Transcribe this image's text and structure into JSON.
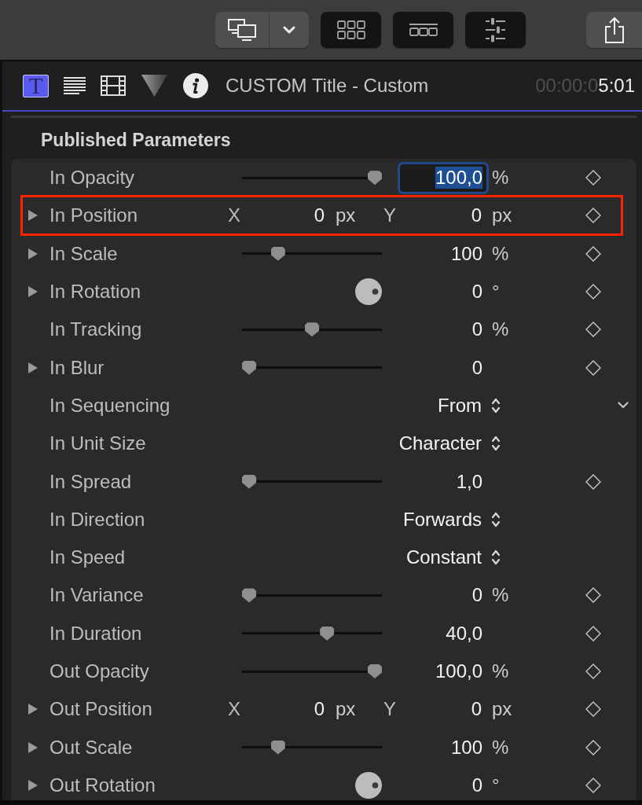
{
  "toolbar": {
    "view_toggles": [
      {
        "kind": "grid",
        "selected": true
      },
      {
        "kind": "timeline",
        "selected": true
      },
      {
        "kind": "sliders",
        "selected": true
      }
    ]
  },
  "inspector": {
    "tabs": [
      {
        "kind": "title",
        "glyph": "T",
        "selected": true
      },
      {
        "kind": "text",
        "selected": false
      },
      {
        "kind": "video",
        "selected": false
      },
      {
        "kind": "color",
        "selected": false
      },
      {
        "kind": "info",
        "selected": false
      }
    ],
    "title": "CUSTOM Title - Custom",
    "timecode": {
      "dim": "00:00:0",
      "lit": "5:01"
    }
  },
  "section": {
    "heading": "Published Parameters",
    "rows": [
      {
        "kind": "slider",
        "label": "In Opacity",
        "level": 1,
        "value": "100,0",
        "unit": "%",
        "focused": true,
        "keyframe": false
      },
      {
        "kind": "position",
        "label": "In Position",
        "expanded": false,
        "highlighted": true,
        "x": {
          "axis": "X",
          "value": "0",
          "unit": "px"
        },
        "y": {
          "axis": "Y",
          "value": "0",
          "unit": "px"
        },
        "keyframe": false
      },
      {
        "kind": "slider",
        "label": "In Scale",
        "expanded": false,
        "level": 0.23,
        "value": "100",
        "unit": "%",
        "focused": false,
        "keyframe": false
      },
      {
        "kind": "dial",
        "label": "In Rotation",
        "expanded": false,
        "value": "0",
        "unit": "°",
        "keyframe": false
      },
      {
        "kind": "slider",
        "label": "In Tracking",
        "level": 0.5,
        "value": "0",
        "unit": "%",
        "focused": false,
        "keyframe": false
      },
      {
        "kind": "slider",
        "label": "In Blur",
        "expanded": false,
        "level": 0,
        "value": "0",
        "focused": false,
        "keyframe": false
      },
      {
        "kind": "popup",
        "label": "In Sequencing",
        "value": "From",
        "menu_chevron": true
      },
      {
        "kind": "popup",
        "label": "In Unit Size",
        "value": "Character"
      },
      {
        "kind": "slider",
        "label": "In Spread",
        "level": 0,
        "value": "1,0",
        "focused": false,
        "keyframe": false
      },
      {
        "kind": "popup",
        "label": "In Direction",
        "value": "Forwards"
      },
      {
        "kind": "popup",
        "label": "In Speed",
        "value": "Constant"
      },
      {
        "kind": "slider",
        "label": "In Variance",
        "level": 0,
        "value": "0",
        "unit": "%",
        "focused": false,
        "keyframe": false
      },
      {
        "kind": "slider",
        "label": "In Duration",
        "level": 0.62,
        "value": "40,0",
        "focused": false,
        "keyframe": false
      },
      {
        "kind": "slider",
        "label": "Out Opacity",
        "level": 1,
        "value": "100,0",
        "unit": "%",
        "focused": false,
        "keyframe": false
      },
      {
        "kind": "position",
        "label": "Out Position",
        "expanded": false,
        "x": {
          "axis": "X",
          "value": "0",
          "unit": "px"
        },
        "y": {
          "axis": "Y",
          "value": "0",
          "unit": "px"
        },
        "keyframe": false
      },
      {
        "kind": "slider",
        "label": "Out Scale",
        "expanded": false,
        "level": 0.23,
        "value": "100",
        "unit": "%",
        "focused": false,
        "keyframe": false
      },
      {
        "kind": "dial",
        "label": "Out Rotation",
        "expanded": false,
        "value": "0",
        "unit": "°",
        "keyframe": false
      }
    ]
  }
}
